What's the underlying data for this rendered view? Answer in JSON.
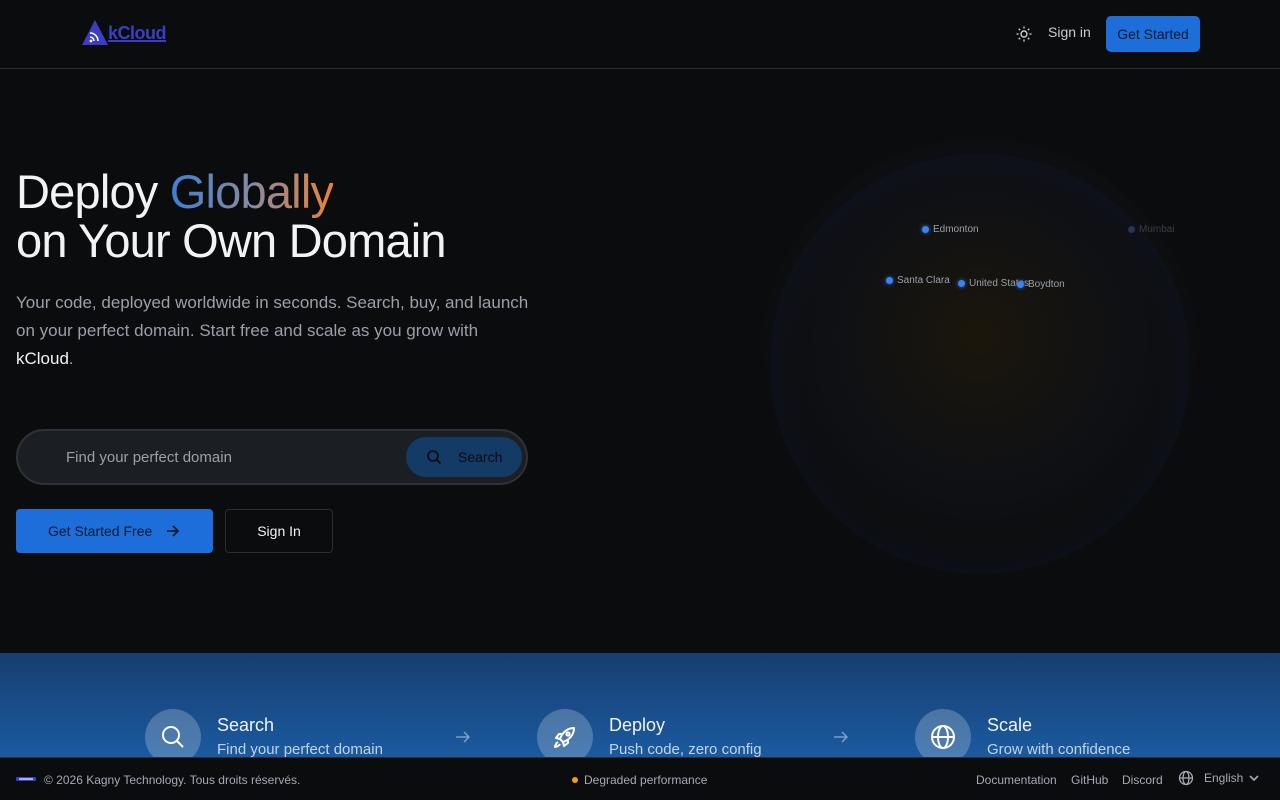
{
  "nav": {
    "logo_text": "kCloud",
    "theme_icon": "sun-icon",
    "signin_label": "Sign in",
    "get_started_label": "Get Started"
  },
  "hero": {
    "title_part1": "Deploy ",
    "title_highlight": "Globally",
    "title_line2": "on Your Own Domain",
    "desc_main": "Your code, deployed worldwide in seconds. Search, buy, and launch on your perfect domain. Start free and scale as you grow with ",
    "desc_brand": "kCloud",
    "desc_end": ".",
    "search_placeholder": "Find your perfect domain",
    "search_button_label": "Search",
    "cta_primary_label": "Get Started Free",
    "cta_secondary_label": "Sign In"
  },
  "globe": {
    "cities": [
      {
        "name": "Edmonton"
      },
      {
        "name": "Mumbai"
      },
      {
        "name": "Santa Clara"
      },
      {
        "name": "United States"
      },
      {
        "name": "Boydton"
      }
    ]
  },
  "steps": [
    {
      "title": "Search",
      "subtitle": "Find your perfect domain",
      "icon": "search-icon"
    },
    {
      "title": "Deploy",
      "subtitle": "Push code, zero config",
      "icon": "rocket-icon"
    },
    {
      "title": "Scale",
      "subtitle": "Grow with confidence",
      "icon": "globe-icon"
    }
  ],
  "footer": {
    "copyright": "© 2026 Kagny Technology. Tous droits réservés.",
    "status": "Degraded performance",
    "status_color": "#f59e0b",
    "links": [
      "Documentation",
      "GitHub",
      "Discord"
    ],
    "language": "English"
  },
  "colors": {
    "accent": "#1d6ed8",
    "background": "#0b0c0e"
  }
}
